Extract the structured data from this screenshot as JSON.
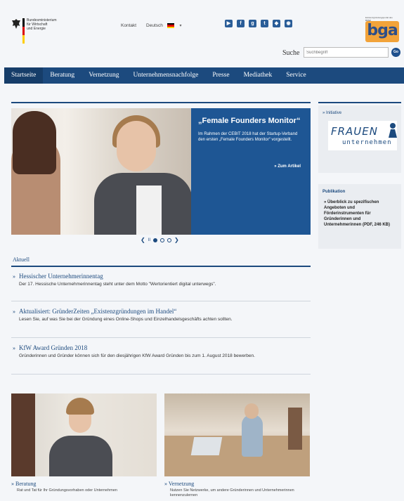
{
  "header": {
    "ministry_lines": [
      "Bundesministerium",
      "für Wirtschaft",
      "und Energie"
    ],
    "contact": "Kontakt",
    "language": "Deutsch",
    "social_icons": [
      "youtube-icon",
      "facebook-icon",
      "googleplus-icon",
      "twitter-icon",
      "delicious-icon",
      "rss-icon"
    ],
    "logo_caption": "Existenzgründungsportal des BMWi",
    "logo_text": "bga",
    "search_label": "Suche",
    "search_placeholder": "Suchbegriff",
    "search_button": "Go"
  },
  "nav": {
    "items": [
      "Startseite",
      "Beratung",
      "Vernetzung",
      "Unternehmensnachfolge",
      "Presse",
      "Mediathek",
      "Service"
    ]
  },
  "hero": {
    "title": "„Female Founders Monitor“",
    "text": "Im Rahmen der CEBIT 2018 hat der Startup-Verband den ersten „Female Founders Monitor“ vorgestellt.",
    "link": "Zum Artikel"
  },
  "carousel": {
    "prev": "❮",
    "pause": "II",
    "next": "❯"
  },
  "aktuell": {
    "heading": "Aktuell",
    "items": [
      {
        "title": "Hessischer Unternehmerinnentag",
        "desc": "Der 17. Hessische Unternehmerinnentag steht unter dem Motto \"Wertorientiert digital unterwegs\"."
      },
      {
        "title": "Aktualisiert: GründerZeiten „Existenzgründungen im Handel“",
        "desc": "Lesen Sie, auf was Sie bei der Gründung eines Online-Shops und Einzelhandelsgeschäfts achten sollten."
      },
      {
        "title": "KfW Award Gründen 2018",
        "desc": "Gründerinnen und Gründer können sich für den diesjährigen KfW Award Gründen bis zum 1. August 2018 bewerben."
      }
    ]
  },
  "sidebar": {
    "initiative_label": "Initiative",
    "frauen_top": "FRAUEN",
    "frauen_bottom": "unternehmen",
    "publication_label": "Publikation",
    "publication_text": "Überblick zu spezifischen Angeboten und Förderinstrumenten für Gründerinnen und Unternehmerinnen (PDF, 246 KB)"
  },
  "cards": [
    {
      "title": "Beratung",
      "desc": "Rat und Tat für Ihr Gründungsvorhaben oder Unternehmen"
    },
    {
      "title": "Vernetzung",
      "desc": "Nutzen Sie Netzwerke, um andere Gründerinnen und Unternehmerinnen kennenzulernen"
    }
  ],
  "colors": {
    "primary": "#1c4a7e",
    "hero_box": "#1e5694",
    "logo_orange": "#f2a33a"
  }
}
